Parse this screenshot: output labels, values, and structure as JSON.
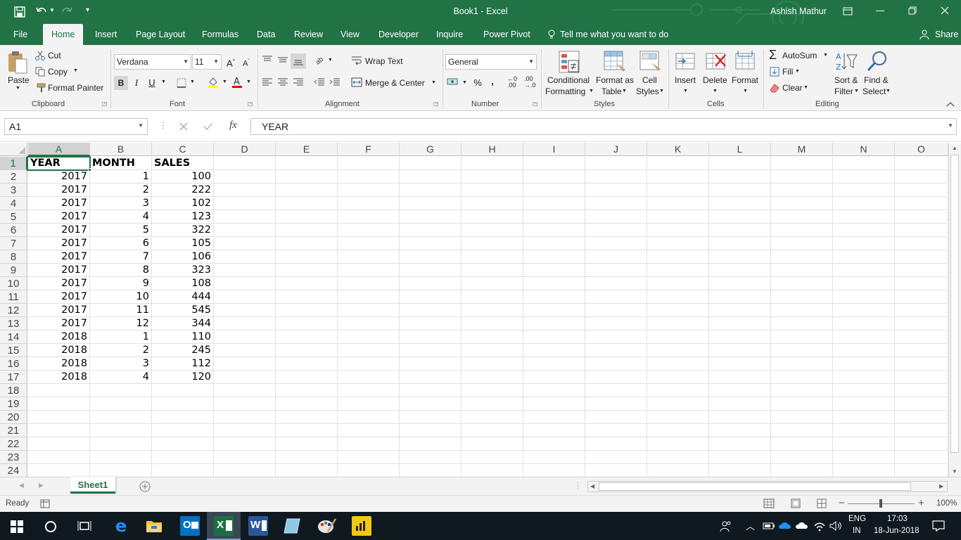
{
  "window": {
    "title": "Book1  -  Excel",
    "user": "Ashish Mathur"
  },
  "tabs": [
    "File",
    "Home",
    "Insert",
    "Page Layout",
    "Formulas",
    "Data",
    "Review",
    "View",
    "Developer",
    "Inquire",
    "Power Pivot"
  ],
  "tell_me": "Tell me what you want to do",
  "share": "Share",
  "ribbon": {
    "clipboard": {
      "paste": "Paste",
      "cut": "Cut",
      "copy": "Copy",
      "format_painter": "Format Painter",
      "label": "Clipboard"
    },
    "font": {
      "name": "Verdana",
      "size": "11",
      "label": "Font"
    },
    "alignment": {
      "wrap": "Wrap Text",
      "merge": "Merge & Center",
      "label": "Alignment"
    },
    "number": {
      "format": "General",
      "label": "Number"
    },
    "styles": {
      "cond1": "Conditional",
      "cond2": "Formatting",
      "fmt1": "Format as",
      "fmt2": "Table",
      "cell1": "Cell",
      "cell2": "Styles",
      "label": "Styles"
    },
    "cells": {
      "insert": "Insert",
      "delete": "Delete",
      "format": "Format",
      "label": "Cells"
    },
    "editing": {
      "autosum": "AutoSum",
      "fill": "Fill",
      "clear": "Clear",
      "sort1": "Sort &",
      "sort2": "Filter",
      "find1": "Find &",
      "find2": "Select",
      "label": "Editing"
    }
  },
  "formula_bar": {
    "name_box": "A1",
    "fx": "fx",
    "value": "YEAR"
  },
  "columns": [
    "A",
    "B",
    "C",
    "D",
    "E",
    "F",
    "G",
    "H",
    "I",
    "J",
    "K",
    "L",
    "M",
    "N",
    "O"
  ],
  "rows": [
    "1",
    "2",
    "3",
    "4",
    "5",
    "6",
    "7",
    "8",
    "9",
    "10",
    "11",
    "12",
    "13",
    "14",
    "15",
    "16",
    "17",
    "18",
    "19",
    "20",
    "21",
    "22",
    "23",
    "24"
  ],
  "table": {
    "headers": [
      "YEAR",
      "MONTH",
      "SALES"
    ],
    "data": [
      [
        "2017",
        "1",
        "100"
      ],
      [
        "2017",
        "2",
        "222"
      ],
      [
        "2017",
        "3",
        "102"
      ],
      [
        "2017",
        "4",
        "123"
      ],
      [
        "2017",
        "5",
        "322"
      ],
      [
        "2017",
        "6",
        "105"
      ],
      [
        "2017",
        "7",
        "106"
      ],
      [
        "2017",
        "8",
        "323"
      ],
      [
        "2017",
        "9",
        "108"
      ],
      [
        "2017",
        "10",
        "444"
      ],
      [
        "2017",
        "11",
        "545"
      ],
      [
        "2017",
        "12",
        "344"
      ],
      [
        "2018",
        "1",
        "110"
      ],
      [
        "2018",
        "2",
        "245"
      ],
      [
        "2018",
        "3",
        "112"
      ],
      [
        "2018",
        "4",
        "120"
      ]
    ]
  },
  "sheet_tab": "Sheet1",
  "status": {
    "ready": "Ready",
    "zoom": "100%"
  },
  "taskbar": {
    "lang1": "ENG",
    "lang2": "IN",
    "time": "17:03",
    "date": "18-Jun-2018"
  },
  "colors": {
    "excel_green": "#217346",
    "ribbon_bg": "#f3f3f3",
    "taskbar_bg": "#101820"
  }
}
